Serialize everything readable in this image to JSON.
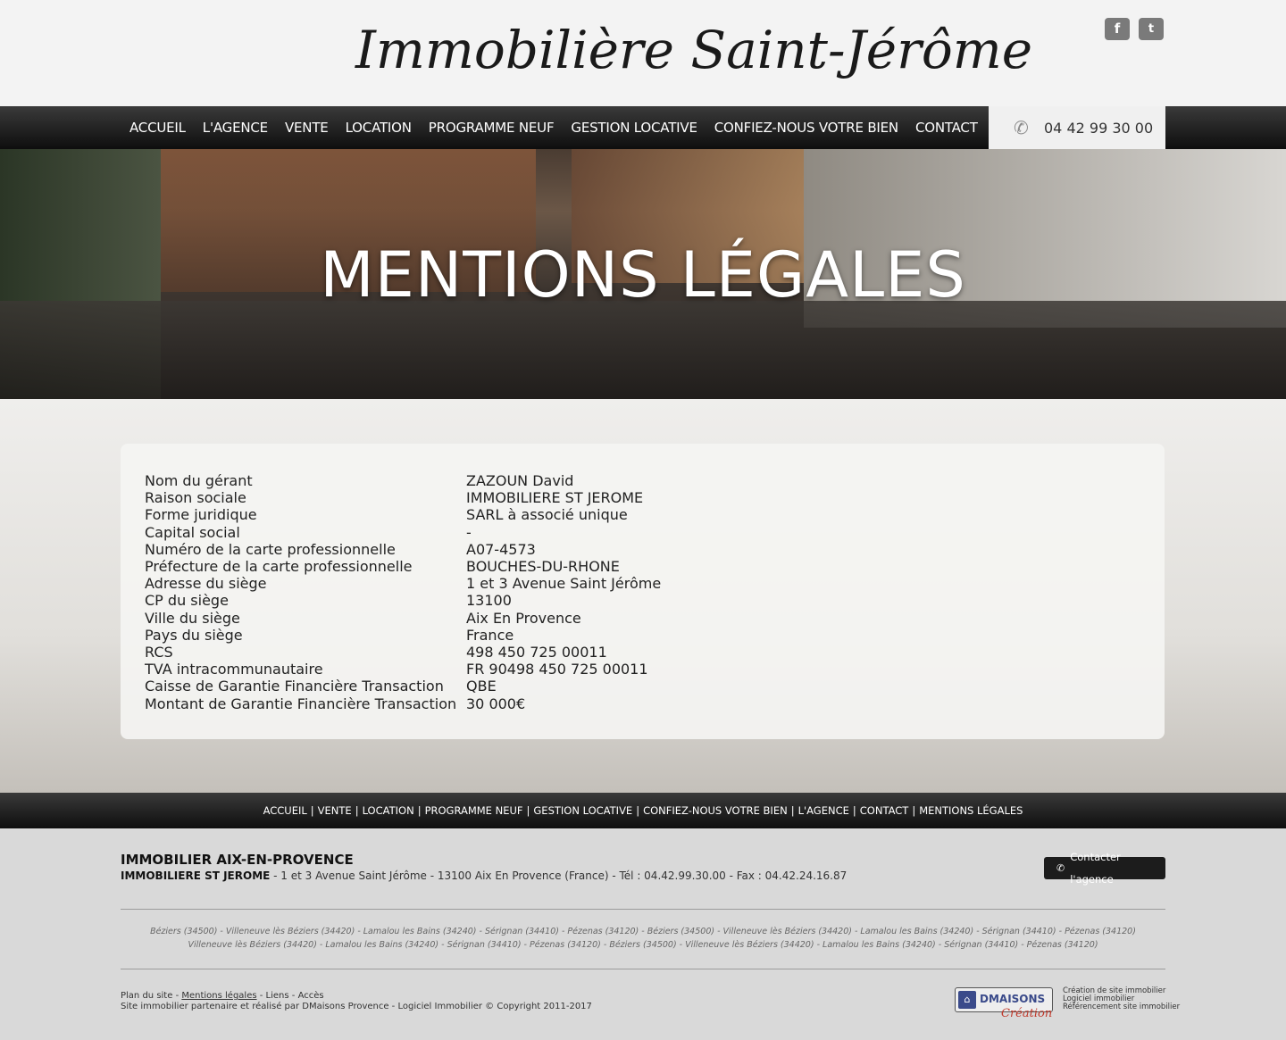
{
  "header": {
    "logo": "Immobilière Saint-Jérôme",
    "social": {
      "facebook": "f",
      "twitter": "t"
    }
  },
  "nav": {
    "items": [
      "ACCUEIL",
      "L'AGENCE",
      "VENTE",
      "LOCATION",
      "PROGRAMME NEUF",
      "GESTION LOCATIVE",
      "CONFIEZ-NOUS VOTRE BIEN",
      "CONTACT"
    ],
    "phone": "04 42 99 30 00"
  },
  "hero": {
    "title": "MENTIONS LÉGALES"
  },
  "legal": [
    [
      "Nom du gérant",
      "ZAZOUN David"
    ],
    [
      "Raison sociale",
      "IMMOBILIERE ST JEROME"
    ],
    [
      "Forme juridique",
      "SARL à associé unique"
    ],
    [
      "Capital social",
      "-"
    ],
    [
      "Numéro de la carte professionnelle",
      "A07-4573"
    ],
    [
      "Préfecture de la carte professionnelle",
      "BOUCHES-DU-RHONE"
    ],
    [
      "Adresse du siège",
      "1 et 3 Avenue Saint Jérôme"
    ],
    [
      "CP du siège",
      "13100"
    ],
    [
      "Ville du siège",
      "Aix En Provence"
    ],
    [
      "Pays du siège",
      "France"
    ],
    [
      "RCS",
      "498 450 725 00011"
    ],
    [
      "TVA intracommunautaire",
      "FR 90498 450 725 00011"
    ],
    [
      "Caisse de Garantie Financière Transaction",
      "QBE"
    ],
    [
      "Montant de Garantie Financière Transaction",
      "30 000€"
    ]
  ],
  "footer_nav": [
    "ACCUEIL",
    "VENTE",
    "LOCATION",
    "PROGRAMME NEUF",
    "GESTION LOCATIVE",
    "CONFIEZ-NOUS VOTRE BIEN",
    "L'AGENCE",
    "CONTACT",
    "MENTIONS LÉGALES"
  ],
  "footer": {
    "title": "IMMOBILIER AIX-EN-PROVENCE",
    "company": "IMMOBILIERE ST JEROME",
    "address": " - 1 et 3 Avenue Saint Jérôme - 13100 Aix En Provence (France) - Tél : 04.42.99.30.00 - Fax : 04.42.24.16.87",
    "contact_button": "Contacter l'agence",
    "cities_line1": "Béziers (34500) - Villeneuve lès Béziers (34420) - Lamalou les Bains (34240) - Sérignan (34410) - Pézenas (34120) - Béziers (34500) - Villeneuve lès Béziers (34420) - Lamalou les Bains (34240) - Sérignan (34410) - Pézenas (34120)",
    "cities_line2": "Villeneuve lès Béziers (34420) - Lamalou les Bains (34240) - Sérignan (34410) - Pézenas (34120) - Béziers (34500) - Villeneuve lès Béziers (34420) - Lamalou les Bains (34240) - Sérignan (34410) - Pézenas (34120)",
    "links": {
      "plan": "Plan du site",
      "sep": " - ",
      "mentions": "Mentions légales",
      "liens": "Liens",
      "acces": "Accès"
    },
    "credit": "Site immobilier partenaire et réalisé par DMaisons Provence - Logiciel Immobilier © Copyright 2011-2017",
    "dm_name": "DMAISONS",
    "dm_sub": "Création",
    "dm_lines": [
      "Création de site immobilier",
      "Logiciel immobilier",
      "Référencement site immobilier"
    ]
  }
}
